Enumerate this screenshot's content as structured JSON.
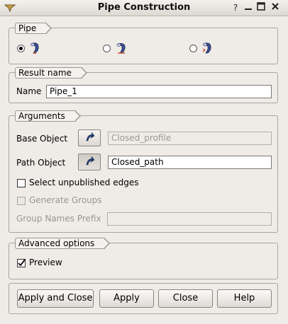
{
  "window": {
    "title": "Pipe Construction",
    "help_glyph": "?",
    "minimize_glyph": "—",
    "maximize_glyph": "☐",
    "close_glyph": "✕"
  },
  "pipe_group": {
    "title": "Pipe",
    "options": [
      {
        "id": "pipe-option-1",
        "selected": true
      },
      {
        "id": "pipe-option-2",
        "selected": false
      },
      {
        "id": "pipe-option-3",
        "selected": false
      }
    ]
  },
  "result_group": {
    "title": "Result name",
    "name_label": "Name",
    "name_value": "Pipe_1"
  },
  "arguments_group": {
    "title": "Arguments",
    "base_label": "Base Object",
    "base_value": "Closed_profile",
    "path_label": "Path Object",
    "path_value": "Closed_path",
    "select_unpublished_label": "Select unpublished edges",
    "select_unpublished_checked": false,
    "generate_groups_label": "Generate Groups",
    "generate_groups_checked": false,
    "group_prefix_label": "Group Names Prefix",
    "group_prefix_value": ""
  },
  "advanced_group": {
    "title": "Advanced options",
    "preview_label": "Preview",
    "preview_checked": true
  },
  "buttons": {
    "apply_close": "Apply and Close",
    "apply": "Apply",
    "close": "Close",
    "help": "Help"
  },
  "colors": {
    "background": "#efebe7",
    "pipe_icon": "#3b4f8f",
    "selection_arrow": "#24407a"
  }
}
